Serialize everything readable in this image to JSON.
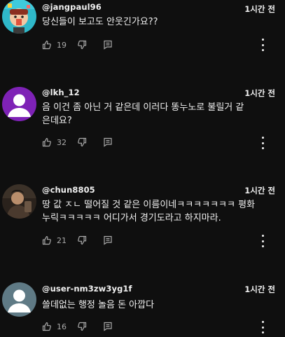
{
  "comments": [
    {
      "author": "@jangpaul96",
      "time": "1시간 전",
      "text": "당신들이 보고도 안웃긴가요??",
      "likes": "19",
      "avatar": {
        "type": "image-cartoon",
        "bg": "#2fb8c9"
      }
    },
    {
      "author": "@lkh_12",
      "time": "1시간 전",
      "text": "음 이건 좀 아닌 거 같은데 이러다 똥누노로 불릴거 같\n은데요?",
      "likes": "32",
      "avatar": {
        "type": "default",
        "bg": "#7e22b6"
      }
    },
    {
      "author": "@chun8805",
      "time": "1시간 전",
      "text": "땅 값 ㅈㄴ 떨어질 것 같은 이름이네ㅋㅋㅋㅋㅋㅋㅋ 평화\n누릭ㅋㅋㅋㅋㅋ 어디가서 경기도라고 하지마라.",
      "likes": "21",
      "avatar": {
        "type": "image-photo",
        "bg": "#2a221c"
      }
    },
    {
      "author": "@user-nm3zw3yg1f",
      "time": "1시간 전",
      "text": "쓸데없는 행정 놀음   돈 아깝다",
      "likes": "16",
      "avatar": {
        "type": "default",
        "bg": "#5f7a85"
      }
    }
  ],
  "icons": {
    "like": "thumbs-up-icon",
    "dislike": "thumbs-down-icon",
    "reply": "reply-icon",
    "more": "more-vertical-icon"
  }
}
